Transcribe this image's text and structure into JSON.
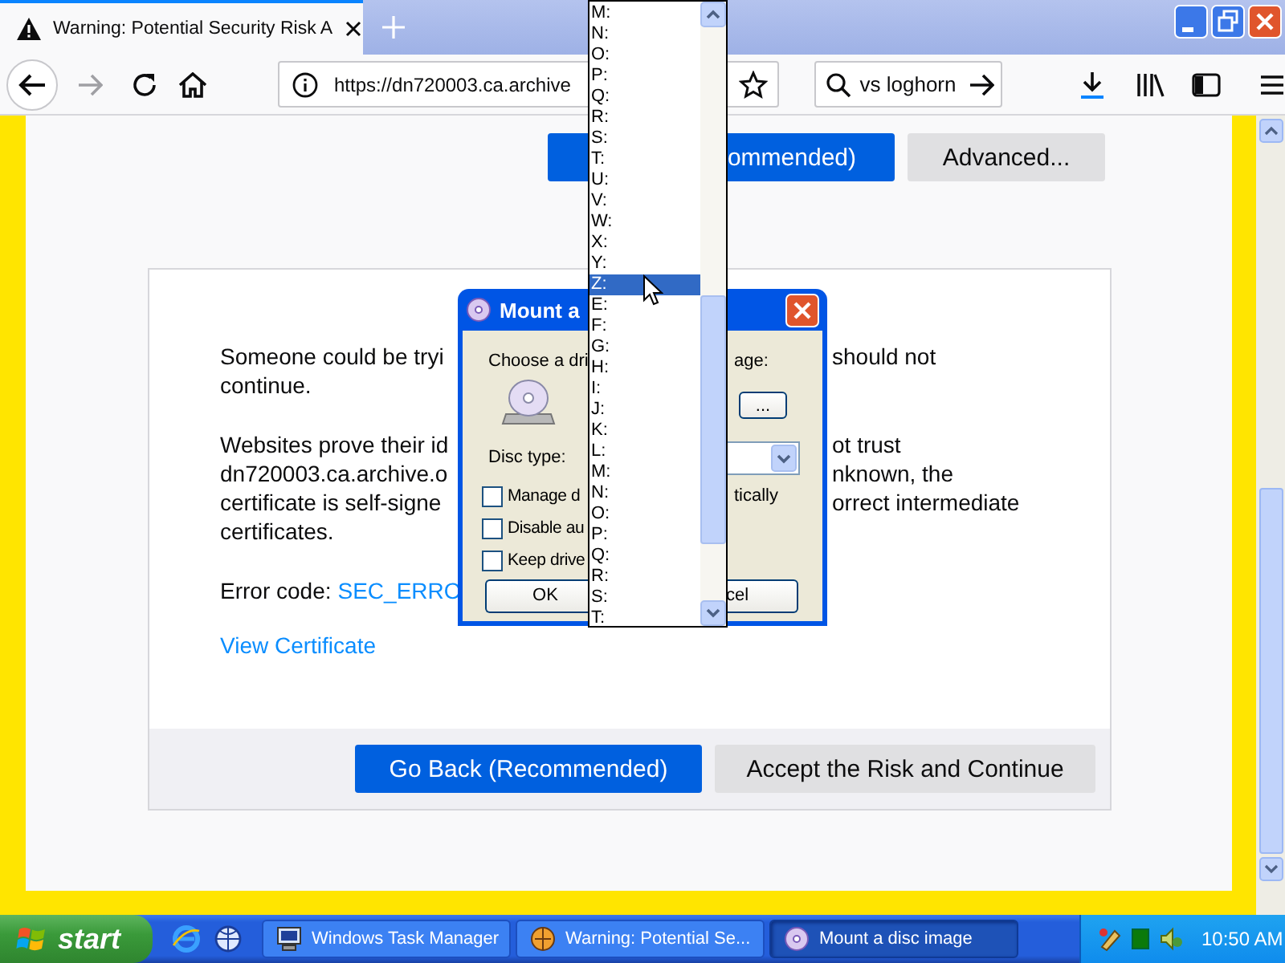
{
  "browser": {
    "tab": {
      "title": "Warning: Potential Security Risk A",
      "selected": true
    },
    "url": "https://dn720003.ca.archive",
    "search": {
      "value": "vs loghorn"
    }
  },
  "page": {
    "top_buttons": [
      {
        "label": "ommended)",
        "kind": "primary"
      },
      {
        "label": "Advanced...",
        "kind": "secondary"
      }
    ],
    "paragraphs": [
      {
        "lines": [
          {
            "left": "Someone could be tryi",
            "right": "should not"
          },
          {
            "left": "continue."
          }
        ]
      },
      {
        "lines": [
          {
            "left": "Websites prove their id",
            "right": "ot trust"
          },
          {
            "left": "dn720003.ca.archive.o",
            "right": "nknown, the"
          },
          {
            "left": "certificate is self-signe",
            "right": "orrect intermediate"
          },
          {
            "left": "certificates."
          }
        ]
      }
    ],
    "error_label": "Error code:",
    "error_code": "SEC_ERRO",
    "view_certificate": "View Certificate",
    "buttons": [
      {
        "label": "Go Back (Recommended)",
        "kind": "primary"
      },
      {
        "label": "Accept the Risk and Continue",
        "kind": "secondary"
      }
    ]
  },
  "dialog": {
    "title": "Mount a",
    "choose_label": "Choose a dri",
    "choose_label_right": "age:",
    "browse_button": "...",
    "disc_type_label": "Disc type:",
    "checkboxes": [
      {
        "label": "Manage d",
        "label_right": "tically",
        "checked": false
      },
      {
        "label": "Disable au",
        "checked": false
      },
      {
        "label": "Keep drive",
        "checked": false
      }
    ],
    "ok_button": "OK",
    "cancel_button": "cel"
  },
  "drive_list": {
    "items": [
      {
        "label": "M:",
        "selected": false
      },
      {
        "label": "N:",
        "selected": false
      },
      {
        "label": "O:",
        "selected": false
      },
      {
        "label": "P:",
        "selected": false
      },
      {
        "label": "Q:",
        "selected": false
      },
      {
        "label": "R:",
        "selected": false
      },
      {
        "label": "S:",
        "selected": false
      },
      {
        "label": "T:",
        "selected": false
      },
      {
        "label": "U:",
        "selected": false
      },
      {
        "label": "V:",
        "selected": false
      },
      {
        "label": "W:",
        "selected": false
      },
      {
        "label": "X:",
        "selected": false
      },
      {
        "label": "Y:",
        "selected": false
      },
      {
        "label": "Z:",
        "selected": true
      },
      {
        "label": "E:",
        "selected": false
      },
      {
        "label": "F:",
        "selected": false
      },
      {
        "label": "G:",
        "selected": false
      },
      {
        "label": "H:",
        "selected": false
      },
      {
        "label": "I:",
        "selected": false
      },
      {
        "label": "J:",
        "selected": false
      },
      {
        "label": "K:",
        "selected": false
      },
      {
        "label": "L:",
        "selected": false
      },
      {
        "label": "M:",
        "selected": false
      },
      {
        "label": "N:",
        "selected": false
      },
      {
        "label": "O:",
        "selected": false
      },
      {
        "label": "P:",
        "selected": false
      },
      {
        "label": "Q:",
        "selected": false
      },
      {
        "label": "R:",
        "selected": false
      },
      {
        "label": "S:",
        "selected": false
      },
      {
        "label": "T:",
        "selected": false
      }
    ]
  },
  "taskbar": {
    "start": "start",
    "tasks": [
      {
        "label": "Windows Task Manager",
        "kind": "monitor",
        "selected": false
      },
      {
        "label": "Warning: Potential Se...",
        "kind": "browser",
        "selected": false
      },
      {
        "label": "Mount a disc image",
        "kind": "disc",
        "selected": true
      }
    ],
    "clock": "10:50 AM"
  }
}
